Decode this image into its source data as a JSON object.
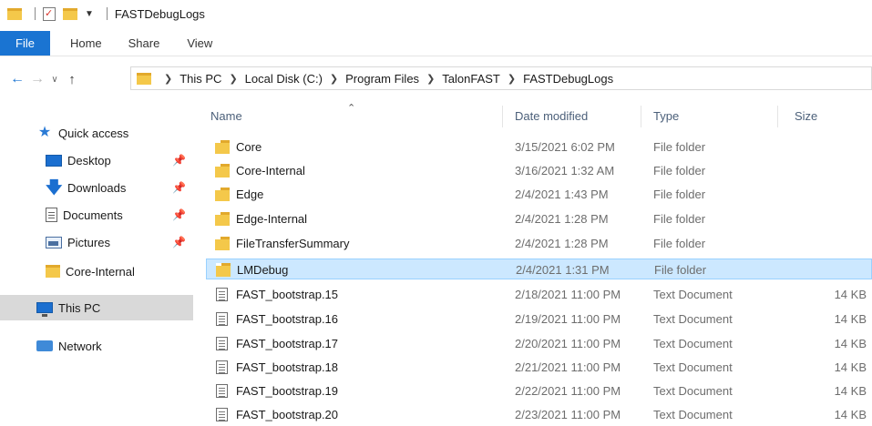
{
  "window": {
    "title": "FASTDebugLogs"
  },
  "ribbon": {
    "tabs": [
      {
        "label": "File"
      },
      {
        "label": "Home"
      },
      {
        "label": "Share"
      },
      {
        "label": "View"
      }
    ]
  },
  "address": {
    "crumbs": [
      "This PC",
      "Local Disk (C:)",
      "Program Files",
      "TalonFAST",
      "FASTDebugLogs"
    ]
  },
  "nav": {
    "items": [
      {
        "label": "Quick access",
        "icon": "star-icon"
      },
      {
        "label": "Desktop",
        "icon": "desktop-icon",
        "pinned": true
      },
      {
        "label": "Downloads",
        "icon": "download-icon",
        "pinned": true
      },
      {
        "label": "Documents",
        "icon": "documents-icon",
        "pinned": true
      },
      {
        "label": "Pictures",
        "icon": "pictures-icon",
        "pinned": true
      },
      {
        "label": "Core-Internal",
        "icon": "folder-icon"
      },
      {
        "label": "This PC",
        "icon": "computer-icon",
        "selected": true
      },
      {
        "label": "Network",
        "icon": "network-icon"
      }
    ]
  },
  "columns": {
    "name": "Name",
    "date": "Date modified",
    "type": "Type",
    "size": "Size"
  },
  "files": [
    {
      "name": "Core",
      "date": "3/15/2021 6:02 PM",
      "type": "File folder",
      "size": "",
      "kind": "folder"
    },
    {
      "name": "Core-Internal",
      "date": "3/16/2021 1:32 AM",
      "type": "File folder",
      "size": "",
      "kind": "folder"
    },
    {
      "name": "Edge",
      "date": "2/4/2021 1:43 PM",
      "type": "File folder",
      "size": "",
      "kind": "folder"
    },
    {
      "name": "Edge-Internal",
      "date": "2/4/2021 1:28 PM",
      "type": "File folder",
      "size": "",
      "kind": "folder"
    },
    {
      "name": "FileTransferSummary",
      "date": "2/4/2021 1:28 PM",
      "type": "File folder",
      "size": "",
      "kind": "folder"
    },
    {
      "name": "LMDebug",
      "date": "2/4/2021 1:31 PM",
      "type": "File folder",
      "size": "",
      "kind": "folder",
      "selected": true
    },
    {
      "name": "FAST_bootstrap.15",
      "date": "2/18/2021 11:00 PM",
      "type": "Text Document",
      "size": "14 KB",
      "kind": "text"
    },
    {
      "name": "FAST_bootstrap.16",
      "date": "2/19/2021 11:00 PM",
      "type": "Text Document",
      "size": "14 KB",
      "kind": "text"
    },
    {
      "name": "FAST_bootstrap.17",
      "date": "2/20/2021 11:00 PM",
      "type": "Text Document",
      "size": "14 KB",
      "kind": "text"
    },
    {
      "name": "FAST_bootstrap.18",
      "date": "2/21/2021 11:00 PM",
      "type": "Text Document",
      "size": "14 KB",
      "kind": "text"
    },
    {
      "name": "FAST_bootstrap.19",
      "date": "2/22/2021 11:00 PM",
      "type": "Text Document",
      "size": "14 KB",
      "kind": "text"
    },
    {
      "name": "FAST_bootstrap.20",
      "date": "2/23/2021 11:00 PM",
      "type": "Text Document",
      "size": "14 KB",
      "kind": "text"
    }
  ],
  "colors": {
    "accent": "#1a74d2",
    "selection": "#cce8ff",
    "folder": "#f4c84a"
  }
}
